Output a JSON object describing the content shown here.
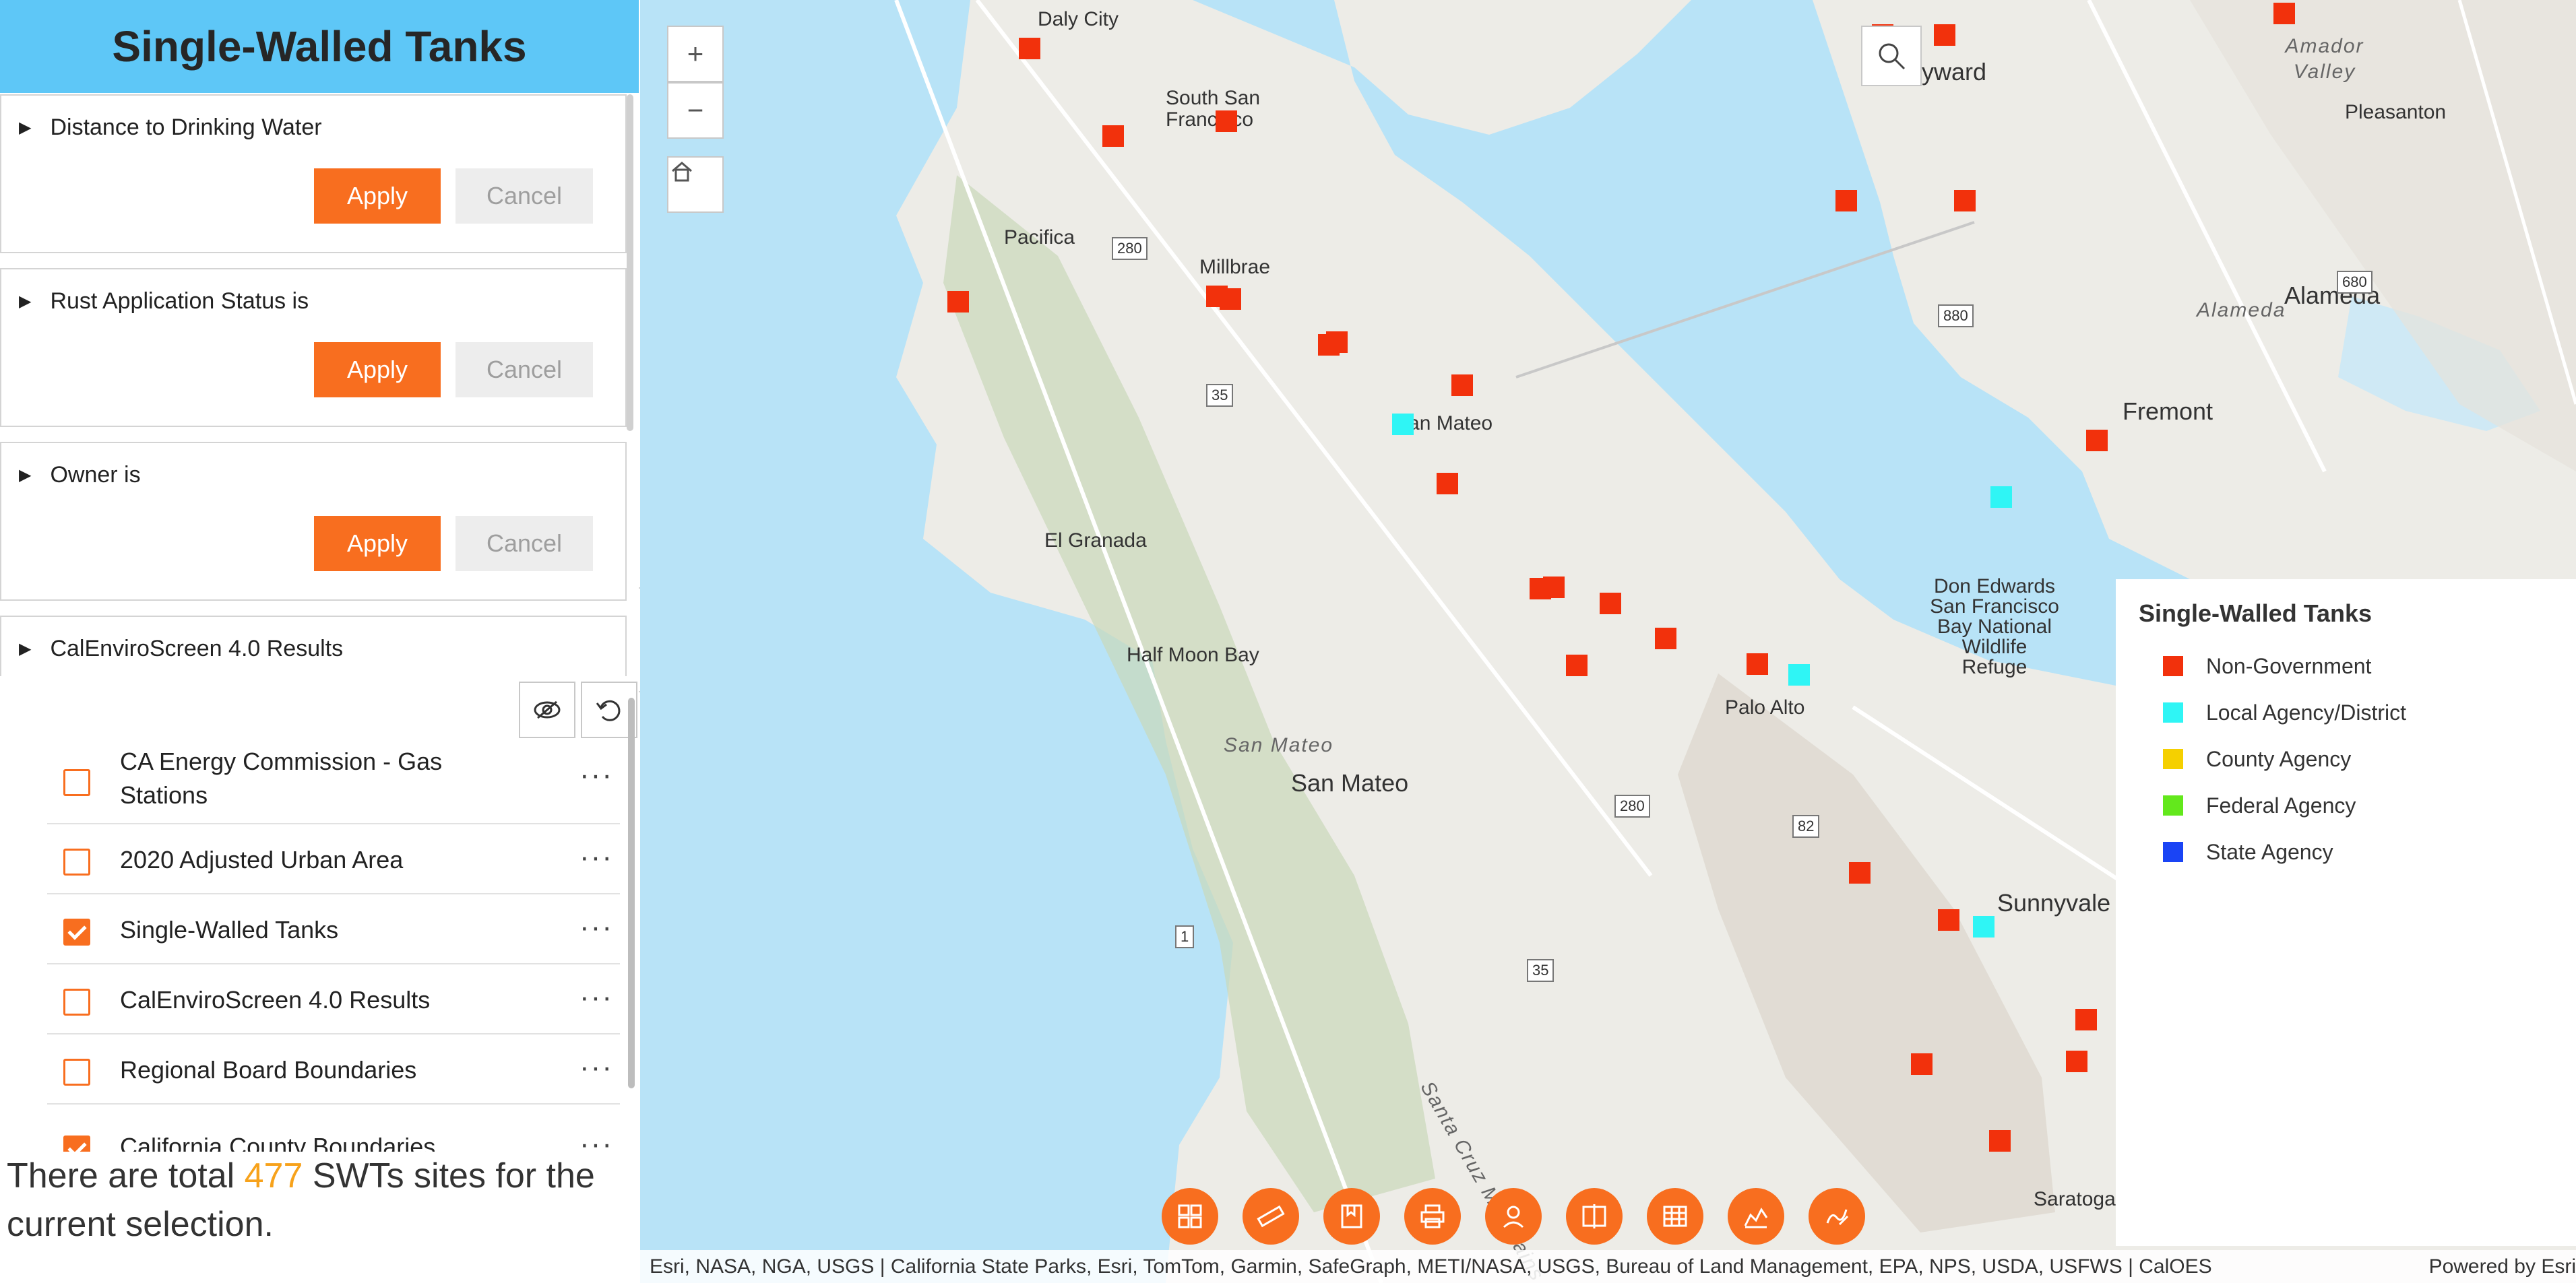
{
  "panel": {
    "title": "Single-Walled Tanks",
    "filters": [
      {
        "label": "Distance to Drinking Water",
        "apply": "Apply",
        "cancel": "Cancel"
      },
      {
        "label": "Rust Application Status is",
        "apply": "Apply",
        "cancel": "Cancel"
      },
      {
        "label": "Owner is",
        "apply": "Apply",
        "cancel": "Cancel"
      },
      {
        "label": "CalEnviroScreen 4.0 Results"
      }
    ],
    "layers": [
      {
        "label": "CA Energy Commission - Gas Stations",
        "checked": false,
        "more": "···"
      },
      {
        "label": "2020 Adjusted Urban Area",
        "checked": false,
        "more": "···"
      },
      {
        "label": "Single-Walled Tanks",
        "checked": true,
        "more": "···"
      },
      {
        "label": "CalEnviroScreen 4.0 Results",
        "checked": false,
        "more": "···"
      },
      {
        "label": "Regional Board Boundaries",
        "checked": false,
        "more": "···"
      },
      {
        "label": "California County Boundaries",
        "checked": true,
        "more": "···"
      }
    ],
    "summary": {
      "prefix": "There are total ",
      "count": "477",
      "suffix": " SWTs sites for the current selection."
    }
  },
  "map": {
    "places": [
      "Daly City",
      "South San Francisco",
      "Pacifica",
      "Millbrae",
      "San Mateo",
      "El Granada",
      "Half Moon Bay",
      "San Mateo",
      "Palo Alto",
      "Hayward",
      "Pleasanton",
      "Alameda",
      "Fremont",
      "Sunnyvale",
      "Saratoga",
      "Don Edwards San Francisco Bay National Wildlife Refuge"
    ],
    "regions": [
      "Amador Valley",
      "Alameda",
      "San Mateo",
      "Santa Cruz Mountains"
    ],
    "highways": [
      "280",
      "880",
      "680",
      "35",
      "82",
      "280",
      "1",
      "35"
    ],
    "controls": {
      "zoom_in": "+",
      "zoom_out": "−"
    }
  },
  "legend": {
    "title": "Single-Walled Tanks",
    "items": [
      {
        "label": "Non-Government",
        "color": "#f2310c"
      },
      {
        "label": "Local Agency/District",
        "color": "#2ff5f5"
      },
      {
        "label": "County Agency",
        "color": "#f5d000"
      },
      {
        "label": "Federal Agency",
        "color": "#63e81c"
      },
      {
        "label": "State Agency",
        "color": "#1a44f5"
      }
    ]
  },
  "attribution": {
    "text": "Esri, NASA, NGA, USGS | California State Parks, Esri, TomTom, Garmin, SafeGraph, METI/NASA, USGS, Bureau of Land Management, EPA, NPS, USDA, USFWS | CalOES",
    "powered": "Powered by Esri"
  },
  "colors": {
    "accent": "#f86e1f",
    "header": "#5ec7f7",
    "water": "#b8e3f7",
    "land": "#edece7",
    "summary_count": "#f7a21b"
  },
  "icons": {
    "tools_panel": [
      "visibility-toggle-icon",
      "reset-icon"
    ],
    "bottom_toolbar": [
      "grid-icon",
      "measure-icon",
      "bookmark-icon",
      "print-icon",
      "locate-icon",
      "swipe-icon",
      "table-icon",
      "chart-icon",
      "draw-icon"
    ]
  }
}
